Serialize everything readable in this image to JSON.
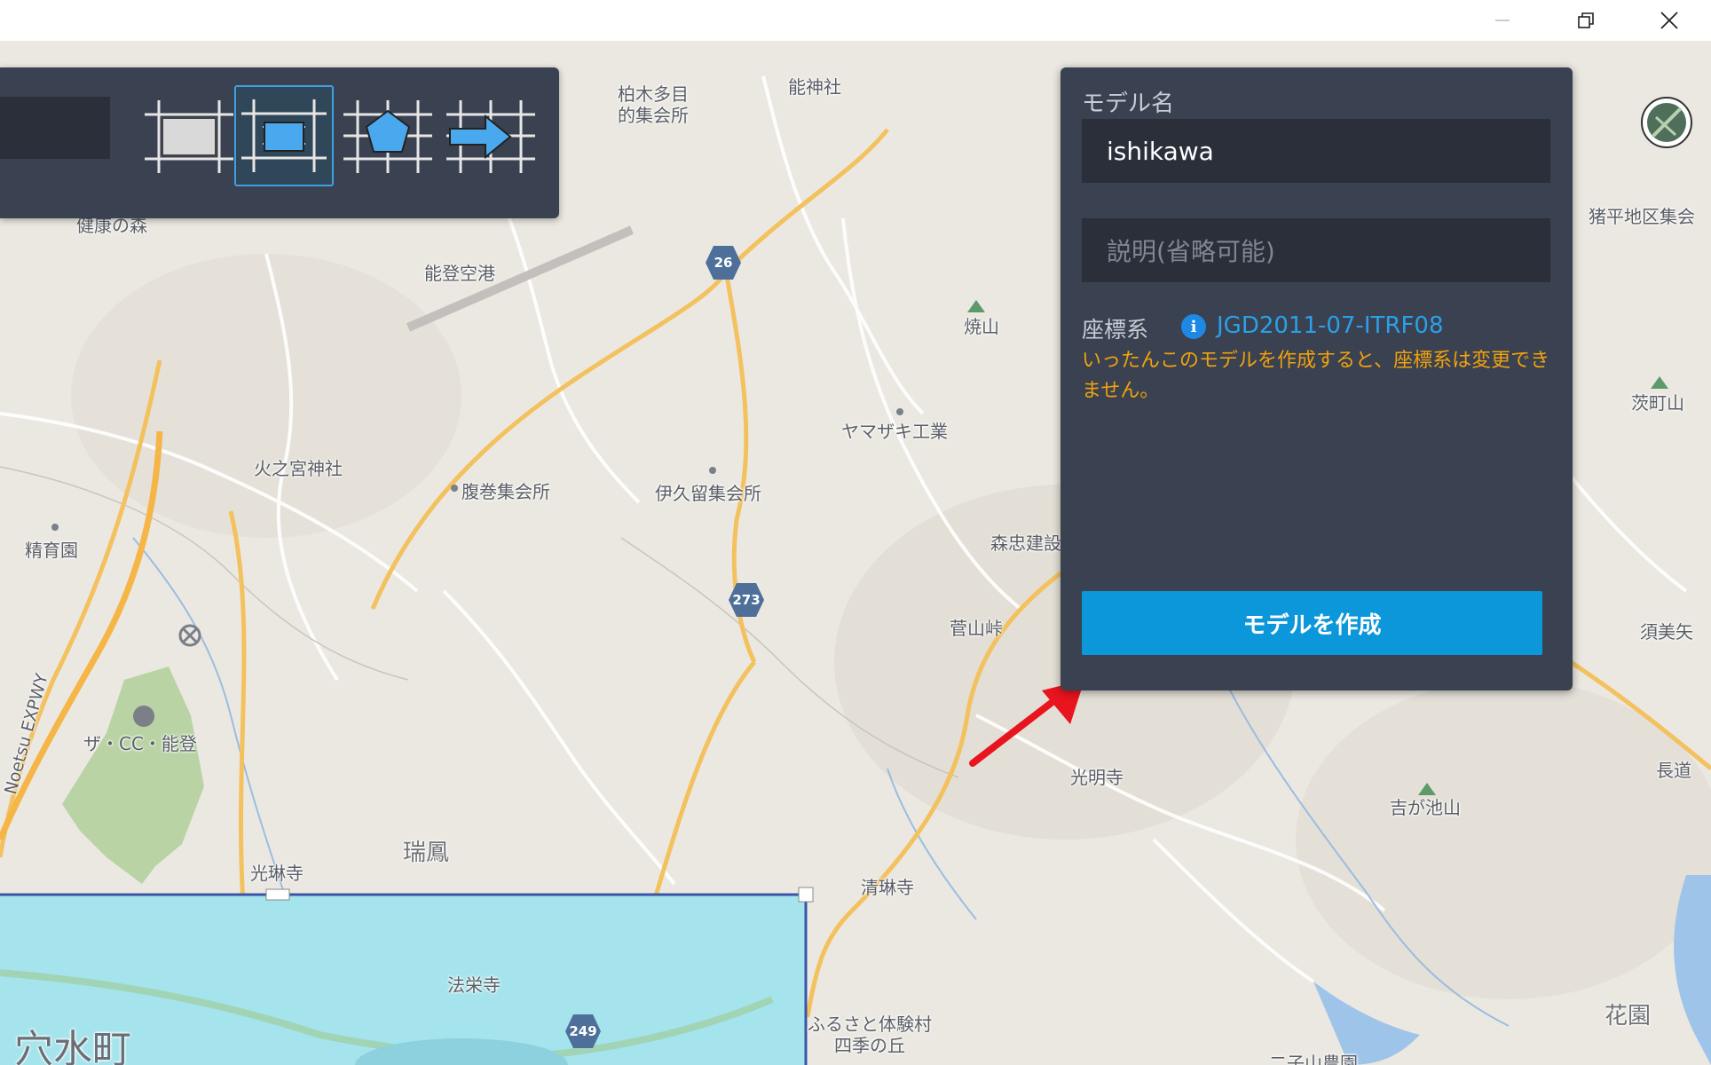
{
  "window": {
    "controls": {
      "minimize_icon": "minimize-icon",
      "restore_icon": "restore-icon",
      "close_icon": "close-icon"
    }
  },
  "toolbar": {
    "tools": [
      {
        "name": "rectangle-area-tool",
        "icon": "rectangle-grid-icon",
        "active": false
      },
      {
        "name": "rectangle-select-tool",
        "icon": "rectangle-select-icon",
        "active": true
      },
      {
        "name": "polygon-tool",
        "icon": "polygon-grid-icon",
        "active": false
      },
      {
        "name": "import-tool",
        "icon": "arrow-grid-icon",
        "active": false
      }
    ]
  },
  "panel": {
    "name_label": "モデル名",
    "name_value": "ishikawa",
    "description_placeholder": "説明(省略可能)",
    "crs_label": "座標系",
    "crs_value": "JGD2011-07-ITRF08",
    "warning": "いったんこのモデルを作成すると、座標系は変更できません。",
    "create_button": "モデルを作成"
  },
  "map": {
    "labels": [
      {
        "key": "kashiwagi",
        "text": "柏木多目\n的集会所"
      },
      {
        "key": "noshin",
        "text": "能神社"
      },
      {
        "key": "kenko",
        "text": "健康の森"
      },
      {
        "key": "airport",
        "text": "能登空港"
      },
      {
        "key": "yakiyama",
        "text": "焼山"
      },
      {
        "key": "inohira",
        "text": "猪平地区集会"
      },
      {
        "key": "ibarahachi",
        "text": "茨町山"
      },
      {
        "key": "yamazaki",
        "text": "ヤマザキ工業"
      },
      {
        "key": "hinomiya",
        "text": "火之宮神社"
      },
      {
        "key": "haramaki",
        "text": "腹巻集会所"
      },
      {
        "key": "ikuru",
        "text": "伊久留集会所"
      },
      {
        "key": "seiikuen",
        "text": "精育園"
      },
      {
        "key": "morichu",
        "text": "森忠建設"
      },
      {
        "key": "sugami",
        "text": "菅山峠"
      },
      {
        "key": "suyoshi",
        "text": "須美矢"
      },
      {
        "key": "expwy",
        "text": "Noetsu EXPWY"
      },
      {
        "key": "thecc",
        "text": "ザ・CC・能登"
      },
      {
        "key": "komyoji",
        "text": "光明寺"
      },
      {
        "key": "yoshiga",
        "text": "吉が池山"
      },
      {
        "key": "nagamichi",
        "text": "長道"
      },
      {
        "key": "mizuho",
        "text": "瑞鳳"
      },
      {
        "key": "korinji",
        "text": "光琳寺"
      },
      {
        "key": "seirinji",
        "text": "清琳寺"
      },
      {
        "key": "hobeiji",
        "text": "法栄寺"
      },
      {
        "key": "anamizu",
        "text": "穴水町"
      },
      {
        "key": "furusato",
        "text": "ふるさと体験村\n四季の丘"
      },
      {
        "key": "futago",
        "text": "二子山農園"
      },
      {
        "key": "hanazono",
        "text": "花園"
      }
    ],
    "routes": [
      {
        "key": "r26",
        "number": "26"
      },
      {
        "key": "r273",
        "number": "273"
      },
      {
        "key": "r249",
        "number": "249"
      }
    ]
  },
  "colors": {
    "panel_bg": "#3a4150",
    "input_bg": "#2a2f3a",
    "accent": "#0b97d9",
    "warning": "#f2a20c",
    "link": "#2aa0e8",
    "selection_fill": "#a5e4ec",
    "selection_border": "#3b55a8",
    "annotation_arrow": "#e8141e"
  }
}
